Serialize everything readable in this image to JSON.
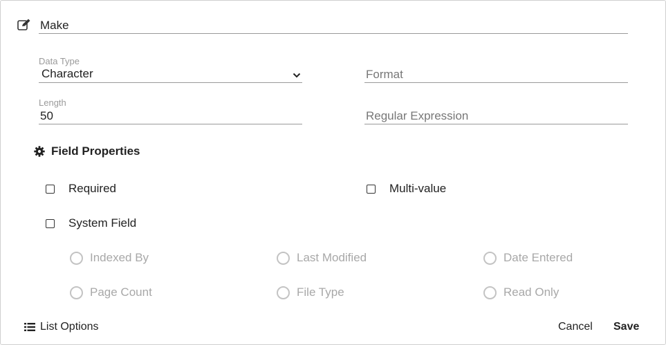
{
  "field_name": {
    "value": "Make"
  },
  "data_type": {
    "label": "Data Type",
    "value": "Character"
  },
  "format": {
    "placeholder": "Format"
  },
  "length": {
    "label": "Length",
    "value": "50"
  },
  "regex": {
    "placeholder": "Regular Expression"
  },
  "field_properties": {
    "title": "Field Properties",
    "required_label": "Required",
    "multi_value_label": "Multi-value",
    "system_field_label": "System Field",
    "system_options": [
      "Indexed By",
      "Last Modified",
      "Date Entered",
      "Page Count",
      "File Type",
      "Read Only"
    ]
  },
  "footer": {
    "list_options_label": "List Options",
    "cancel_label": "Cancel",
    "save_label": "Save"
  },
  "icons": [
    "edit-icon",
    "chevron-down-icon",
    "gear-icon",
    "list-icon"
  ]
}
